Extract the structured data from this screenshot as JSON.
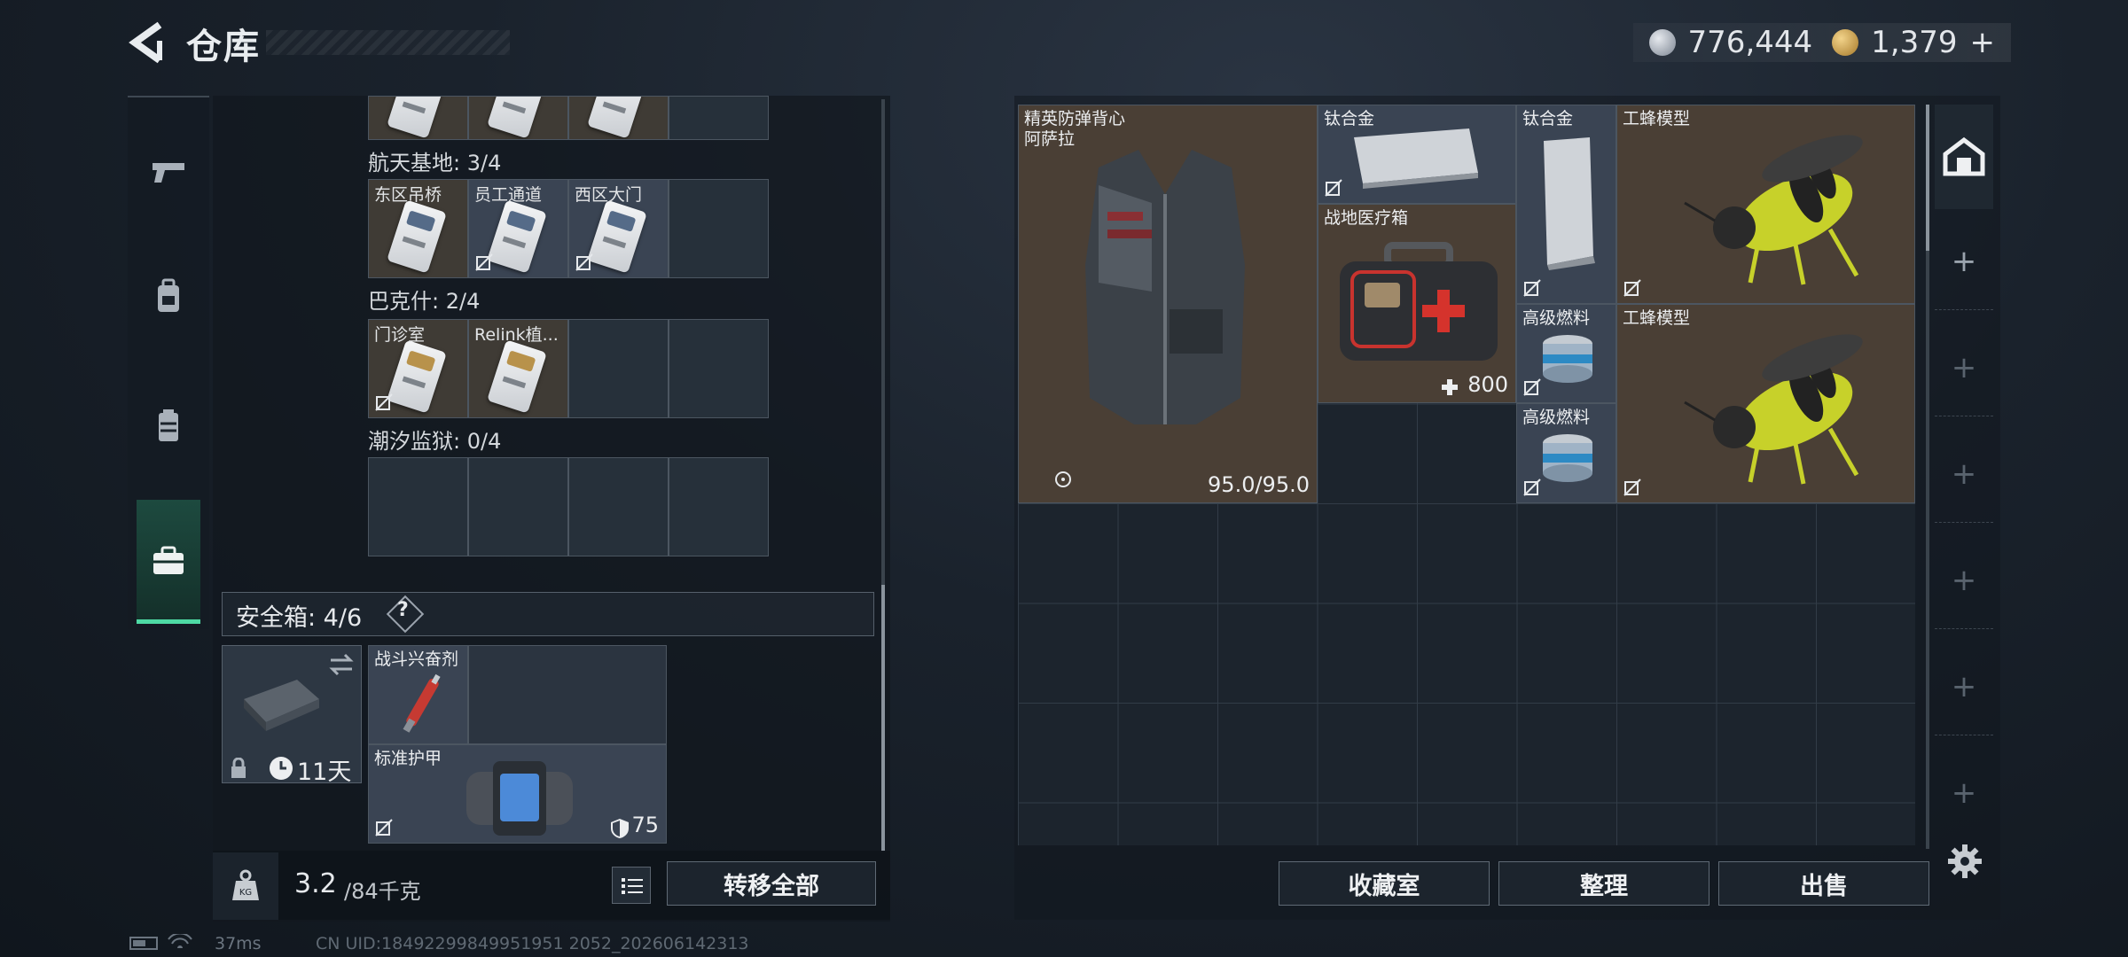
{
  "header": {
    "title": "仓库",
    "currency_silver": "776,444",
    "currency_gold": "1,379",
    "currency_add": "+"
  },
  "left_panel": {
    "sections": [
      {
        "label": "航天基地: 3/4",
        "cells": [
          "东区吊桥",
          "员工通道",
          "西区大门"
        ]
      },
      {
        "label": "巴克什: 2/4",
        "cells": [
          "门诊室",
          "Relink植..."
        ]
      },
      {
        "label": "潮汐监狱: 0/4",
        "cells": []
      }
    ],
    "safebox": {
      "title": "安全箱: 4/6",
      "help": "?",
      "timer": "11天",
      "items": [
        {
          "label": "战斗兴奋剂"
        },
        {
          "label": "标准护甲",
          "value": "75"
        }
      ]
    },
    "weight": {
      "current": "3.2",
      "max": "/84千克"
    },
    "transfer_all": "转移全部"
  },
  "right_panel": {
    "items": [
      {
        "label": "精英防弹背心\n阿萨拉",
        "value": "95.0/95.0"
      },
      {
        "label": "钛合金"
      },
      {
        "label": "钛合金"
      },
      {
        "label": "工蜂模型"
      },
      {
        "label": "战地医疗箱",
        "value": "800"
      },
      {
        "label": "高级燃料"
      },
      {
        "label": "工蜂模型"
      },
      {
        "label": "高级燃料"
      }
    ],
    "buttons": {
      "collection": "收藏室",
      "sort": "整理",
      "sell": "出售"
    }
  },
  "status": {
    "ping": "37ms",
    "uid": "CN UID:18492299849951951 2052_202606142313"
  },
  "colors": {
    "accent_green": "#4ed9a4",
    "item_brown": "#4a3f35",
    "item_slate": "#3a4453"
  }
}
